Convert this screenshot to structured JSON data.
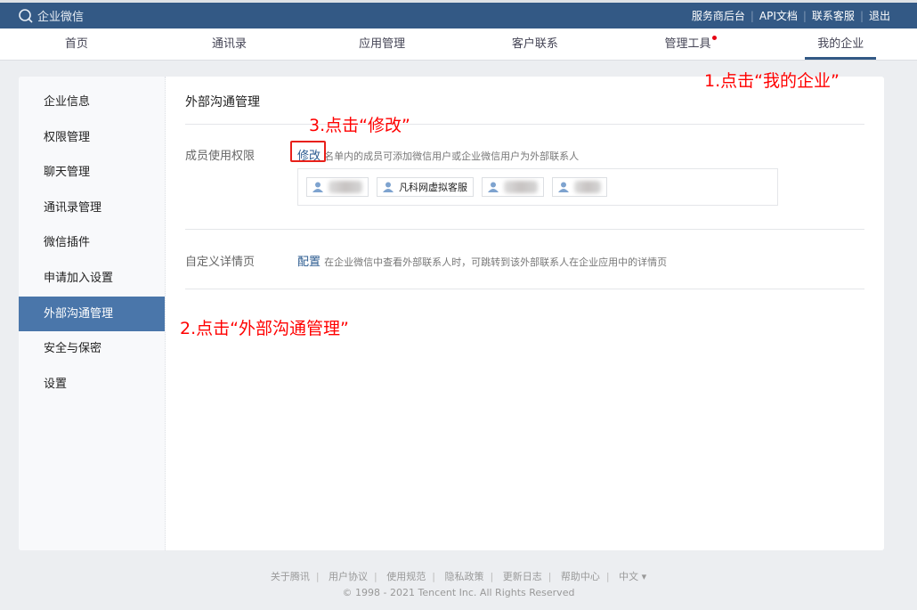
{
  "app": {
    "name": "企业微信"
  },
  "top_links": [
    "服务商后台",
    "API文档",
    "联系客服",
    "退出"
  ],
  "nav": [
    {
      "label": "首页"
    },
    {
      "label": "通讯录"
    },
    {
      "label": "应用管理"
    },
    {
      "label": "客户联系"
    },
    {
      "label": "管理工具",
      "badge": true
    },
    {
      "label": "我的企业",
      "active": true
    }
  ],
  "sidebar": [
    "企业信息",
    "权限管理",
    "聊天管理",
    "通讯录管理",
    "微信插件",
    "申请加入设置",
    "外部沟通管理",
    "安全与保密",
    "设置"
  ],
  "main": {
    "title": "外部沟通管理",
    "member_permission": {
      "label": "成员使用权限",
      "link": "修改",
      "desc": "名单内的成员可添加微信用户或企业微信用户为外部联系人",
      "members": [
        "",
        "凡科网虚拟客服",
        "",
        ""
      ]
    },
    "custom_detail": {
      "label": "自定义详情页",
      "link": "配置",
      "desc": "在企业微信中查看外部联系人时，可跳转到该外部联系人在企业应用中的详情页"
    }
  },
  "annotations": {
    "step1": "1.点击“我的企业”",
    "step2": "2.点击“外部沟通管理”",
    "step3": "3.点击“修改”"
  },
  "footer": {
    "links": [
      "关于腾讯",
      "用户协议",
      "使用规范",
      "隐私政策",
      "更新日志",
      "帮助中心"
    ],
    "language": "中文 ▾",
    "copyright": "© 1998 - 2021 Tencent Inc. All Rights Reserved"
  }
}
